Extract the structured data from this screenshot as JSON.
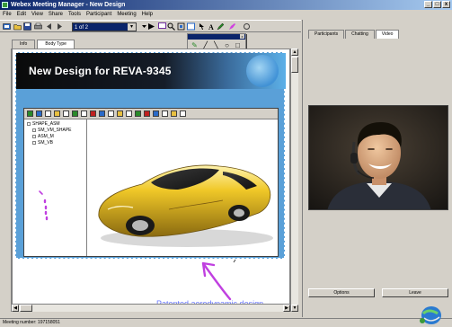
{
  "window": {
    "title": "Webex Meeting Manager - New Design",
    "min": "_",
    "max": "□",
    "close": "x"
  },
  "menu": [
    "File",
    "Edit",
    "View",
    "Share",
    "Tools",
    "Participant",
    "Meeting",
    "Help"
  ],
  "toolbar": {
    "page_selector": "1 of 2",
    "dropdown_arrow": "▾"
  },
  "palette": {
    "close": "x"
  },
  "whiteboard_tabs": [
    "Info",
    "Body Type"
  ],
  "slide": {
    "title": "New Design for REVA-9345"
  },
  "viewer": {
    "tree": [
      {
        "label": "SHAPE_ASM",
        "level": 0
      },
      {
        "label": "SM_VM_SHAPE",
        "level": 1
      },
      {
        "label": "ASM_M",
        "level": 1
      },
      {
        "label": "SM_VB",
        "level": 1
      }
    ]
  },
  "annotation": {
    "caption": "Patented aerodynamic design"
  },
  "status": {
    "text": "Meeting number: 197158051"
  },
  "right_panel": {
    "tabs": [
      "Participants",
      "Chatting",
      "Video"
    ],
    "active_tab": "Video",
    "buttons": [
      "Options",
      "Leave"
    ]
  },
  "scroll": {
    "up": "▲",
    "down": "▼",
    "left": "◀",
    "right": "▶"
  },
  "colors": {
    "title_bar": "#0a246a",
    "slide_background": "#5aa0d8",
    "annotation_pen": "#c040e0",
    "caption_text": "#6a78ff",
    "car_body": "#e8b820"
  }
}
